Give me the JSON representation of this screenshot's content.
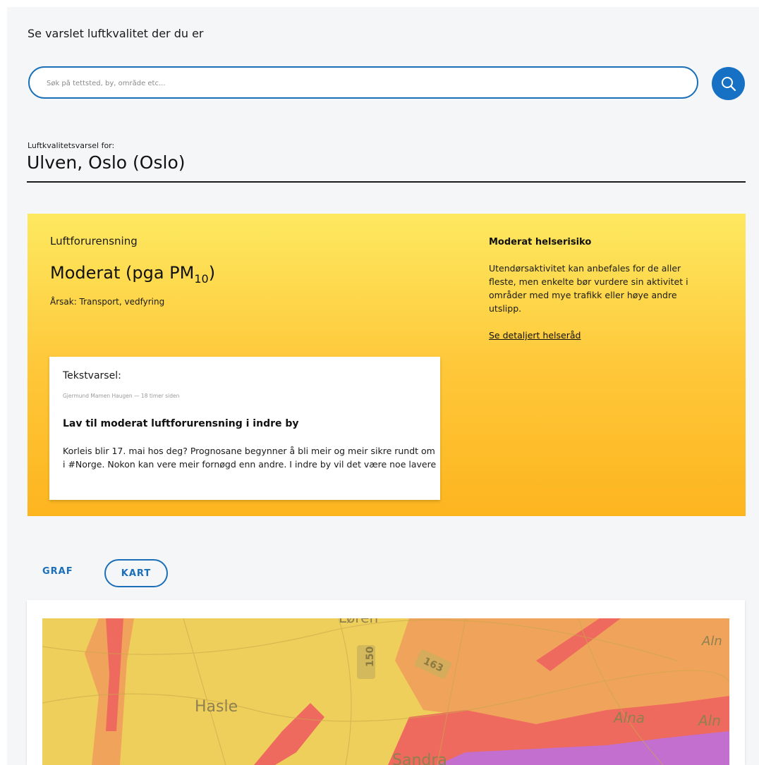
{
  "intro": {
    "text": "Se varslet luftkvalitet der du er"
  },
  "search": {
    "placeholder": "Søk på tettsted, by, område etc...",
    "value": ""
  },
  "location": {
    "label": "Luftkvalitetsvarsel for:",
    "title": "Ulven, Oslo (Oslo)"
  },
  "forecast": {
    "heading": "Luftforurensning",
    "level_prefix": "Moderat (pga PM",
    "level_sub": "10",
    "level_suffix": ")",
    "cause": "Årsak: Transport, vedfyring"
  },
  "health": {
    "title": "Moderat helserisiko",
    "text": "Utendørsaktivitet kan anbefales for de aller fleste, men enkelte bør vurdere sin aktivitet i områder med mye trafikk eller høye andre utslipp.",
    "link": "Se detaljert helseråd"
  },
  "text_forecast": {
    "heading": "Tekstvarsel:",
    "meta": "Gjermund Mamen Haugen — 18 timer siden",
    "title": "Lav til moderat luftforurensning i indre by",
    "body": "Korleis blir 17. mai hos deg? Prognosane begynner å bli meir og meir sikre rundt om i #Norge.  Nokon kan vere meir fornøgd enn andre. I indre by vil det være noe lavere"
  },
  "tabs": {
    "graf": "GRAF",
    "kart": "KART",
    "active": "kart"
  },
  "map": {
    "labels": {
      "hasle": "Hasle",
      "alna": "Alna",
      "alna_right": "Aln",
      "alna_top": "Aln",
      "road_150": "150",
      "road_163": "163",
      "sandra": "Sandra",
      "top": "Løren"
    }
  },
  "colors": {
    "accent": "#1a6fb8",
    "panel_top": "#fde960",
    "panel_bottom": "#fdb51f",
    "map_yellow": "#efcf5c",
    "map_orange": "#f0a35a",
    "map_red": "#ef6a5e",
    "map_purple": "#c26fd0"
  }
}
